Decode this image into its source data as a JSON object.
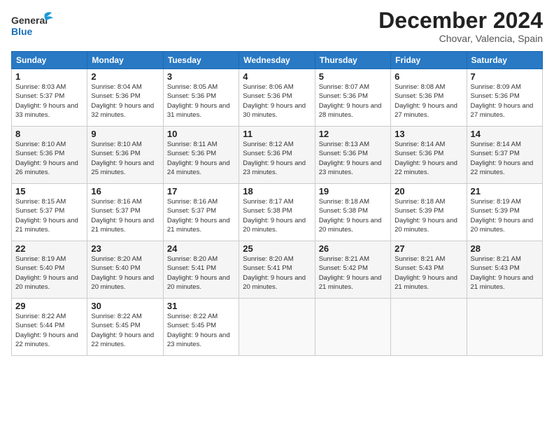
{
  "header": {
    "logo_general": "General",
    "logo_blue": "Blue",
    "month_title": "December 2024",
    "subtitle": "Chovar, Valencia, Spain"
  },
  "calendar": {
    "weekdays": [
      "Sunday",
      "Monday",
      "Tuesday",
      "Wednesday",
      "Thursday",
      "Friday",
      "Saturday"
    ],
    "rows": [
      [
        {
          "day": "1",
          "sunrise": "Sunrise: 8:03 AM",
          "sunset": "Sunset: 5:37 PM",
          "daylight": "Daylight: 9 hours and 33 minutes."
        },
        {
          "day": "2",
          "sunrise": "Sunrise: 8:04 AM",
          "sunset": "Sunset: 5:36 PM",
          "daylight": "Daylight: 9 hours and 32 minutes."
        },
        {
          "day": "3",
          "sunrise": "Sunrise: 8:05 AM",
          "sunset": "Sunset: 5:36 PM",
          "daylight": "Daylight: 9 hours and 31 minutes."
        },
        {
          "day": "4",
          "sunrise": "Sunrise: 8:06 AM",
          "sunset": "Sunset: 5:36 PM",
          "daylight": "Daylight: 9 hours and 30 minutes."
        },
        {
          "day": "5",
          "sunrise": "Sunrise: 8:07 AM",
          "sunset": "Sunset: 5:36 PM",
          "daylight": "Daylight: 9 hours and 28 minutes."
        },
        {
          "day": "6",
          "sunrise": "Sunrise: 8:08 AM",
          "sunset": "Sunset: 5:36 PM",
          "daylight": "Daylight: 9 hours and 27 minutes."
        },
        {
          "day": "7",
          "sunrise": "Sunrise: 8:09 AM",
          "sunset": "Sunset: 5:36 PM",
          "daylight": "Daylight: 9 hours and 27 minutes."
        }
      ],
      [
        {
          "day": "8",
          "sunrise": "Sunrise: 8:10 AM",
          "sunset": "Sunset: 5:36 PM",
          "daylight": "Daylight: 9 hours and 26 minutes."
        },
        {
          "day": "9",
          "sunrise": "Sunrise: 8:10 AM",
          "sunset": "Sunset: 5:36 PM",
          "daylight": "Daylight: 9 hours and 25 minutes."
        },
        {
          "day": "10",
          "sunrise": "Sunrise: 8:11 AM",
          "sunset": "Sunset: 5:36 PM",
          "daylight": "Daylight: 9 hours and 24 minutes."
        },
        {
          "day": "11",
          "sunrise": "Sunrise: 8:12 AM",
          "sunset": "Sunset: 5:36 PM",
          "daylight": "Daylight: 9 hours and 23 minutes."
        },
        {
          "day": "12",
          "sunrise": "Sunrise: 8:13 AM",
          "sunset": "Sunset: 5:36 PM",
          "daylight": "Daylight: 9 hours and 23 minutes."
        },
        {
          "day": "13",
          "sunrise": "Sunrise: 8:14 AM",
          "sunset": "Sunset: 5:36 PM",
          "daylight": "Daylight: 9 hours and 22 minutes."
        },
        {
          "day": "14",
          "sunrise": "Sunrise: 8:14 AM",
          "sunset": "Sunset: 5:37 PM",
          "daylight": "Daylight: 9 hours and 22 minutes."
        }
      ],
      [
        {
          "day": "15",
          "sunrise": "Sunrise: 8:15 AM",
          "sunset": "Sunset: 5:37 PM",
          "daylight": "Daylight: 9 hours and 21 minutes."
        },
        {
          "day": "16",
          "sunrise": "Sunrise: 8:16 AM",
          "sunset": "Sunset: 5:37 PM",
          "daylight": "Daylight: 9 hours and 21 minutes."
        },
        {
          "day": "17",
          "sunrise": "Sunrise: 8:16 AM",
          "sunset": "Sunset: 5:37 PM",
          "daylight": "Daylight: 9 hours and 21 minutes."
        },
        {
          "day": "18",
          "sunrise": "Sunrise: 8:17 AM",
          "sunset": "Sunset: 5:38 PM",
          "daylight": "Daylight: 9 hours and 20 minutes."
        },
        {
          "day": "19",
          "sunrise": "Sunrise: 8:18 AM",
          "sunset": "Sunset: 5:38 PM",
          "daylight": "Daylight: 9 hours and 20 minutes."
        },
        {
          "day": "20",
          "sunrise": "Sunrise: 8:18 AM",
          "sunset": "Sunset: 5:39 PM",
          "daylight": "Daylight: 9 hours and 20 minutes."
        },
        {
          "day": "21",
          "sunrise": "Sunrise: 8:19 AM",
          "sunset": "Sunset: 5:39 PM",
          "daylight": "Daylight: 9 hours and 20 minutes."
        }
      ],
      [
        {
          "day": "22",
          "sunrise": "Sunrise: 8:19 AM",
          "sunset": "Sunset: 5:40 PM",
          "daylight": "Daylight: 9 hours and 20 minutes."
        },
        {
          "day": "23",
          "sunrise": "Sunrise: 8:20 AM",
          "sunset": "Sunset: 5:40 PM",
          "daylight": "Daylight: 9 hours and 20 minutes."
        },
        {
          "day": "24",
          "sunrise": "Sunrise: 8:20 AM",
          "sunset": "Sunset: 5:41 PM",
          "daylight": "Daylight: 9 hours and 20 minutes."
        },
        {
          "day": "25",
          "sunrise": "Sunrise: 8:20 AM",
          "sunset": "Sunset: 5:41 PM",
          "daylight": "Daylight: 9 hours and 20 minutes."
        },
        {
          "day": "26",
          "sunrise": "Sunrise: 8:21 AM",
          "sunset": "Sunset: 5:42 PM",
          "daylight": "Daylight: 9 hours and 21 minutes."
        },
        {
          "day": "27",
          "sunrise": "Sunrise: 8:21 AM",
          "sunset": "Sunset: 5:43 PM",
          "daylight": "Daylight: 9 hours and 21 minutes."
        },
        {
          "day": "28",
          "sunrise": "Sunrise: 8:21 AM",
          "sunset": "Sunset: 5:43 PM",
          "daylight": "Daylight: 9 hours and 21 minutes."
        }
      ],
      [
        {
          "day": "29",
          "sunrise": "Sunrise: 8:22 AM",
          "sunset": "Sunset: 5:44 PM",
          "daylight": "Daylight: 9 hours and 22 minutes."
        },
        {
          "day": "30",
          "sunrise": "Sunrise: 8:22 AM",
          "sunset": "Sunset: 5:45 PM",
          "daylight": "Daylight: 9 hours and 22 minutes."
        },
        {
          "day": "31",
          "sunrise": "Sunrise: 8:22 AM",
          "sunset": "Sunset: 5:45 PM",
          "daylight": "Daylight: 9 hours and 23 minutes."
        },
        null,
        null,
        null,
        null
      ]
    ]
  }
}
